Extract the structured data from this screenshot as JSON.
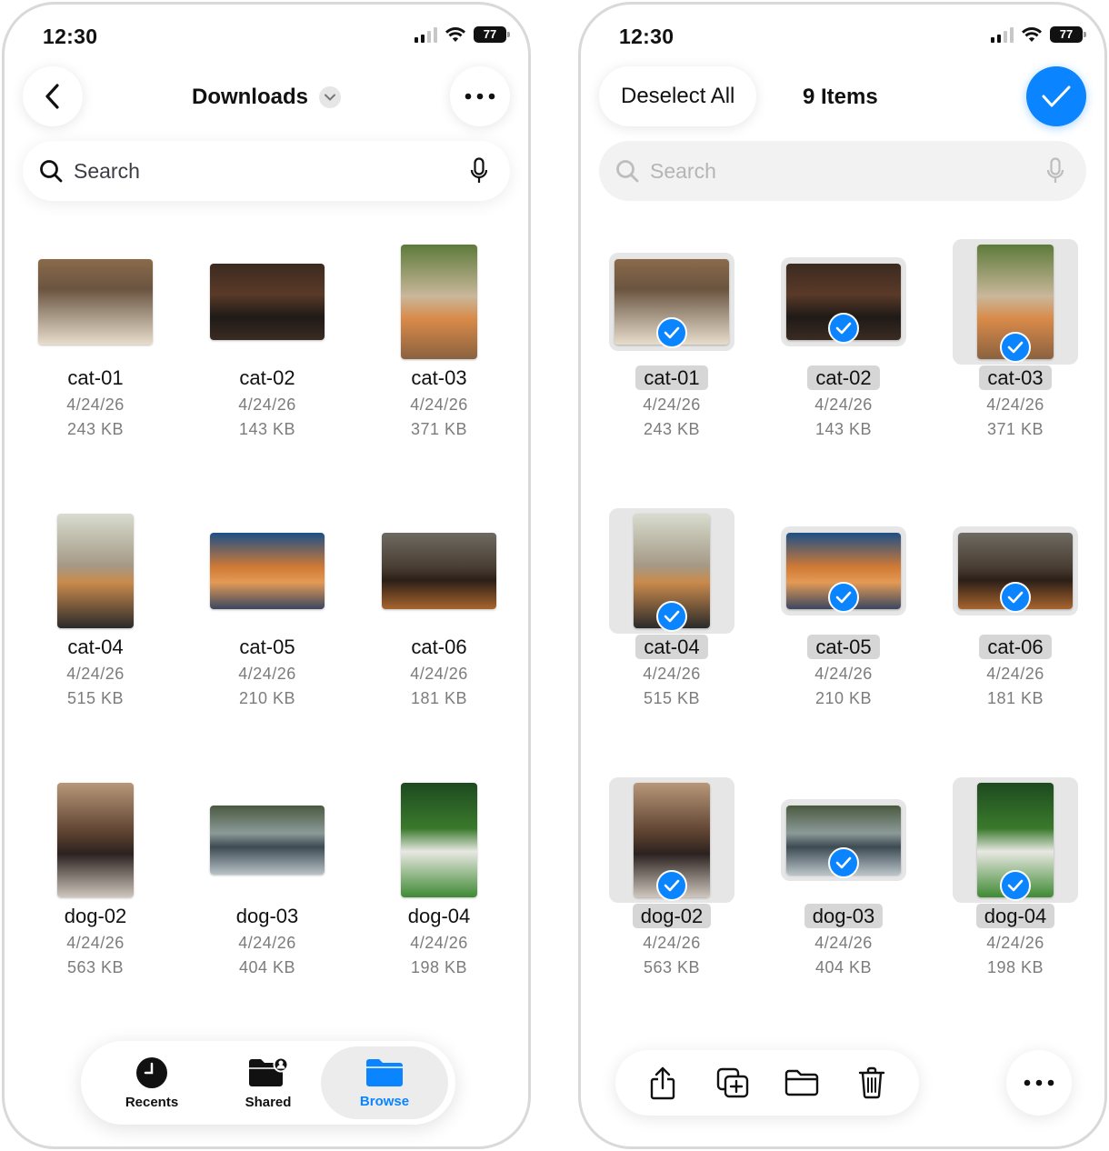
{
  "left": {
    "status": {
      "time": "12:30",
      "battery": "77"
    },
    "header": {
      "title": "Downloads"
    },
    "search": {
      "placeholder": "Search"
    },
    "items": [
      {
        "name": "cat-01",
        "date": "4/24/26",
        "size": "243 KB"
      },
      {
        "name": "cat-02",
        "date": "4/24/26",
        "size": "143 KB"
      },
      {
        "name": "cat-03",
        "date": "4/24/26",
        "size": "371 KB"
      },
      {
        "name": "cat-04",
        "date": "4/24/26",
        "size": "515 KB"
      },
      {
        "name": "cat-05",
        "date": "4/24/26",
        "size": "210 KB"
      },
      {
        "name": "cat-06",
        "date": "4/24/26",
        "size": "181 KB"
      },
      {
        "name": "dog-02",
        "date": "4/24/26",
        "size": "563 KB"
      },
      {
        "name": "dog-03",
        "date": "4/24/26",
        "size": "404 KB"
      },
      {
        "name": "dog-04",
        "date": "4/24/26",
        "size": "198 KB"
      }
    ],
    "tabbar": {
      "recents": "Recents",
      "shared": "Shared",
      "browse": "Browse"
    }
  },
  "right": {
    "status": {
      "time": "12:30",
      "battery": "77"
    },
    "header": {
      "deselect_label": "Deselect All",
      "count_label": "9 Items"
    },
    "search": {
      "placeholder": "Search"
    },
    "items": [
      {
        "name": "cat-01",
        "date": "4/24/26",
        "size": "243 KB"
      },
      {
        "name": "cat-02",
        "date": "4/24/26",
        "size": "143 KB"
      },
      {
        "name": "cat-03",
        "date": "4/24/26",
        "size": "371 KB"
      },
      {
        "name": "cat-04",
        "date": "4/24/26",
        "size": "515 KB"
      },
      {
        "name": "cat-05",
        "date": "4/24/26",
        "size": "210 KB"
      },
      {
        "name": "cat-06",
        "date": "4/24/26",
        "size": "181 KB"
      },
      {
        "name": "dog-02",
        "date": "4/24/26",
        "size": "563 KB"
      },
      {
        "name": "dog-03",
        "date": "4/24/26",
        "size": "404 KB"
      },
      {
        "name": "dog-04",
        "date": "4/24/26",
        "size": "198 KB"
      }
    ],
    "toolbar_icons": [
      "share-icon",
      "duplicate-icon",
      "folder-icon",
      "trash-icon"
    ]
  },
  "colors": {
    "accent": "#0a84ff",
    "selection_bg": "#e6e6e6",
    "secondary_text": "#7c7c7c"
  }
}
